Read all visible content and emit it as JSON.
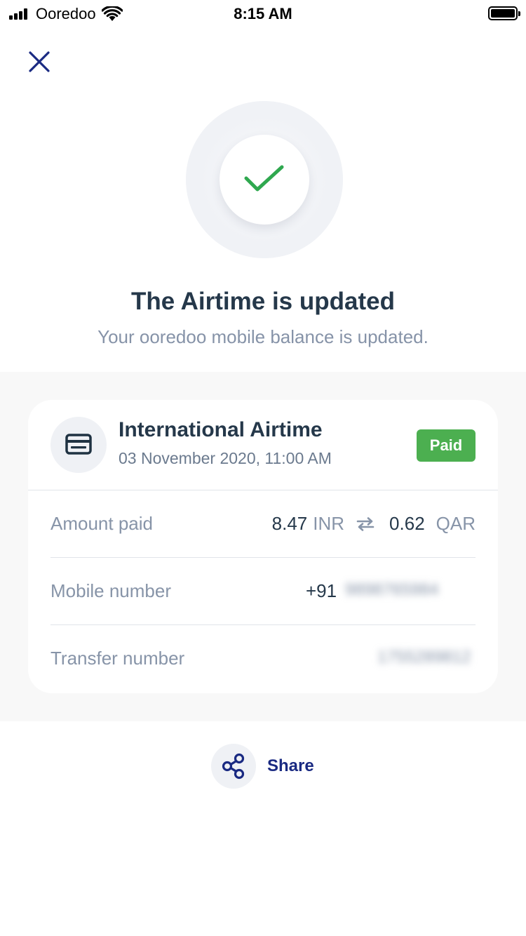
{
  "status_bar": {
    "carrier": "Ooredoo",
    "time": "8:15 AM",
    "icons": [
      "signal-icon",
      "wifi-icon",
      "battery-icon"
    ]
  },
  "header": {
    "close_icon": "close-icon"
  },
  "result": {
    "icon": "check-icon",
    "title": "The Airtime is updated",
    "subtitle": "Your ooredoo mobile balance is updated."
  },
  "transaction": {
    "icon": "card-icon",
    "title": "International Airtime",
    "date": "03 November 2020, 11:00 AM",
    "status": "Paid",
    "rows": {
      "amount": {
        "label": "Amount paid",
        "value": "8.47",
        "currency": "INR",
        "converted_value": "0.62",
        "converted_currency": "QAR",
        "swap_icon": "swap-arrows-icon"
      },
      "mobile": {
        "label": "Mobile number",
        "prefix": "+91",
        "value_blurred": "9898765984"
      },
      "transfer": {
        "label": "Transfer number",
        "value_blurred": "1755289812"
      }
    }
  },
  "share": {
    "icon": "share-icon",
    "label": "Share"
  },
  "colors": {
    "brand_navy": "#1a2a82",
    "success_green": "#2fa84f",
    "paid_badge": "#4caf50",
    "text_dark": "#25384a",
    "text_muted": "#8794a8",
    "band_bg": "#f8f8f8"
  }
}
